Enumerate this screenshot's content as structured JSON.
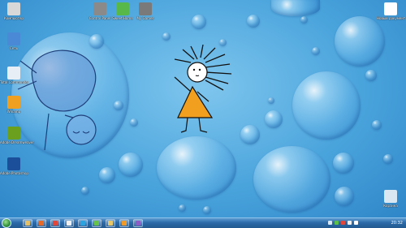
{
  "desktop_icons_left": [
    {
      "label": "Компьютер",
      "name": "computer-icon",
      "color": "#d8d8d8"
    },
    {
      "label": "Корзина",
      "name": "recycle-bin-icon",
      "color": "#cfe6f5"
    },
    {
      "label": "Сеть",
      "name": "network-icon",
      "color": "#4a89d6"
    },
    {
      "label": "Total Commander",
      "name": "floppy-icon",
      "color": "#e8eef5"
    },
    {
      "label": "Winamp",
      "name": "winamp-icon",
      "color": "#f0a020"
    },
    {
      "label": "Adobe Dreamweaver",
      "name": "dreamweaver-icon",
      "color": "#6aa01e"
    },
    {
      "label": "Adobe Photoshop",
      "name": "photoshop-icon",
      "color": "#1b4f9a"
    }
  ],
  "desktop_icons_top": [
    {
      "label": "Control Panel",
      "name": "control-panel-icon",
      "color": "#8a8a8a"
    },
    {
      "label": "Sweet Home",
      "name": "home-icon",
      "color": "#59b84a"
    },
    {
      "label": "My Games",
      "name": "games-icon",
      "color": "#7a7a7a"
    }
  ],
  "desktop_icons_right": [
    {
      "label": "Новый документ",
      "name": "document-icon",
      "color": "#ffffff"
    },
    {
      "label": "Корзина",
      "name": "recycle-bin-icon",
      "color": "#d9e7f3"
    }
  ],
  "taskbar": {
    "clock": "20:32",
    "buttons": [
      {
        "name": "explorer-taskbar-icon",
        "color": "#e2c06a"
      },
      {
        "name": "firefox-taskbar-icon",
        "color": "#e56a2a"
      },
      {
        "name": "chrome-taskbar-icon",
        "color": "#e0463a"
      },
      {
        "name": "media-taskbar-icon",
        "color": "#f0f0f0"
      },
      {
        "name": "skype-taskbar-icon",
        "color": "#2aa3e0"
      },
      {
        "name": "icq-taskbar-icon",
        "color": "#66c24a"
      },
      {
        "name": "folder-taskbar-icon",
        "color": "#e7c76b"
      },
      {
        "name": "winamp-taskbar-icon",
        "color": "#f09a2a"
      },
      {
        "name": "app-taskbar-icon",
        "color": "#8d5cc4"
      }
    ],
    "tray_icons": [
      {
        "name": "tray-icon-1",
        "color": "#d8e8f6"
      },
      {
        "name": "tray-icon-2",
        "color": "#5bbf4a"
      },
      {
        "name": "tray-icon-3",
        "color": "#e0463a"
      },
      {
        "name": "tray-icon-4",
        "color": "#f0f0f0"
      },
      {
        "name": "volume-icon",
        "color": "#ffffff"
      }
    ]
  }
}
